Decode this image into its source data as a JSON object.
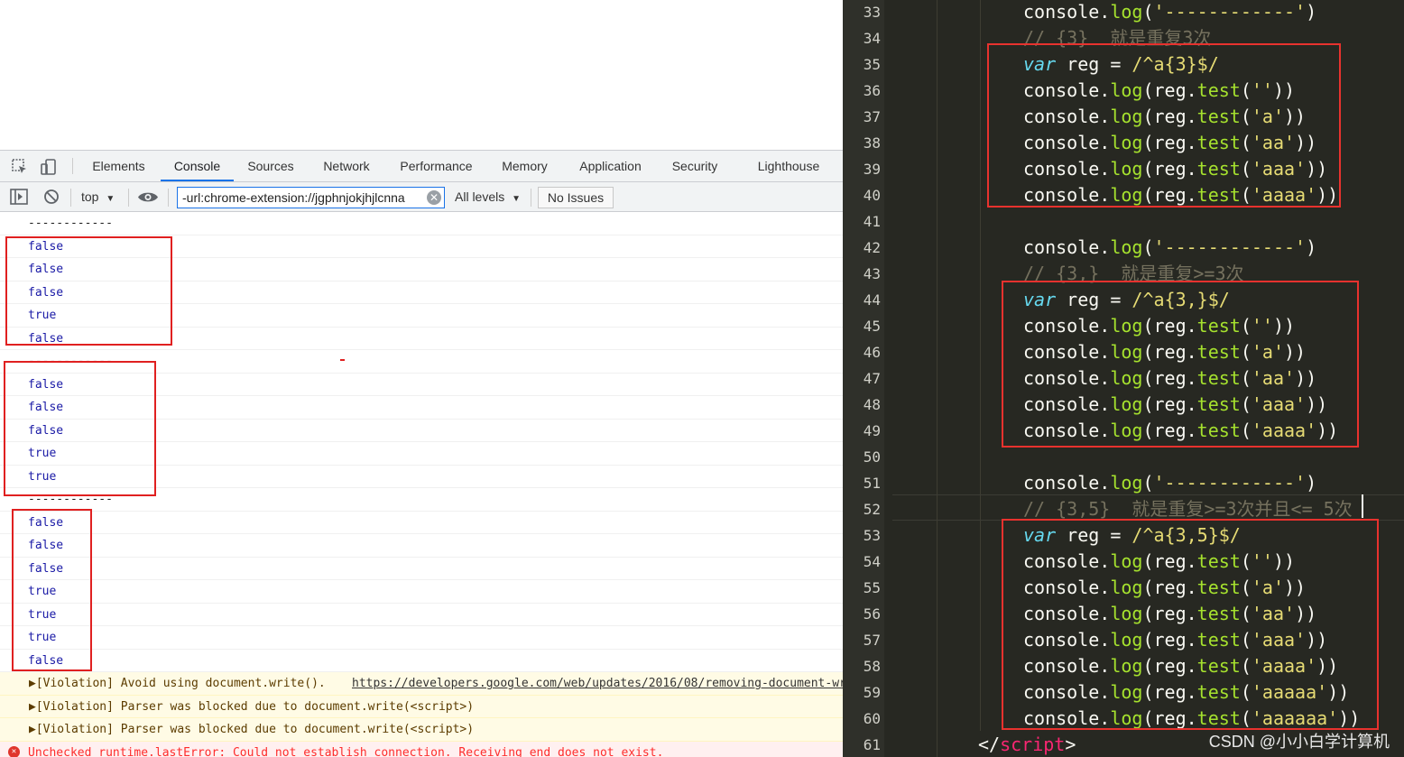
{
  "devtools": {
    "tabs": [
      "Elements",
      "Console",
      "Sources",
      "Network",
      "Performance",
      "Memory",
      "Application",
      "Security",
      "Lighthouse"
    ],
    "active_tab": "Console",
    "context_select": "top",
    "filter_value": "-url:chrome-extension://jgphnjokjhjlcnna",
    "levels_select": "All levels",
    "issues_button": "No Issues"
  },
  "console_rows": [
    {
      "text": "------------",
      "kind": "sep"
    },
    {
      "text": "false",
      "kind": "val"
    },
    {
      "text": "false",
      "kind": "val"
    },
    {
      "text": "false",
      "kind": "val"
    },
    {
      "text": "true",
      "kind": "val"
    },
    {
      "text": "false",
      "kind": "val"
    },
    {
      "text": "------------",
      "kind": "sep"
    },
    {
      "text": "false",
      "kind": "val"
    },
    {
      "text": "false",
      "kind": "val"
    },
    {
      "text": "false",
      "kind": "val"
    },
    {
      "text": "true",
      "kind": "val"
    },
    {
      "text": "true",
      "kind": "val"
    },
    {
      "text": "------------",
      "kind": "sep"
    },
    {
      "text": "false",
      "kind": "val"
    },
    {
      "text": "false",
      "kind": "val"
    },
    {
      "text": "false",
      "kind": "val"
    },
    {
      "text": "true",
      "kind": "val"
    },
    {
      "text": "true",
      "kind": "val"
    },
    {
      "text": "true",
      "kind": "val"
    },
    {
      "text": "false",
      "kind": "val"
    }
  ],
  "violations": [
    {
      "prefix": "▶[Violation] Avoid using document.write(). ",
      "link": "https://developers.google.com/web/updates/2016/08/removing-document-write"
    },
    {
      "prefix": "▶[Violation] Parser was blocked due to document.write(<script>)",
      "link": ""
    },
    {
      "prefix": "▶[Violation] Parser was blocked due to document.write(<script>)",
      "link": ""
    }
  ],
  "error_row": "Unchecked runtime.lastError: Could not establish connection. Receiving end does not exist.",
  "editor": {
    "lines": [
      {
        "n": "33",
        "html": "console.<span class='fn'>log</span>(<span class='str'>'------------'</span>)"
      },
      {
        "n": "34",
        "html": "<span class='cmt'>// {3}  就是重复3次</span>"
      },
      {
        "n": "35",
        "html": "<span class='kw'>var</span> reg = <span class='str'>/^a{3}$/</span>"
      },
      {
        "n": "36",
        "html": "console.<span class='fn'>log</span>(reg.<span class='fn'>test</span>(<span class='str'>''</span>))"
      },
      {
        "n": "37",
        "html": "console.<span class='fn'>log</span>(reg.<span class='fn'>test</span>(<span class='str'>'a'</span>))"
      },
      {
        "n": "38",
        "html": "console.<span class='fn'>log</span>(reg.<span class='fn'>test</span>(<span class='str'>'aa'</span>))"
      },
      {
        "n": "39",
        "html": "console.<span class='fn'>log</span>(reg.<span class='fn'>test</span>(<span class='str'>'aaa'</span>))"
      },
      {
        "n": "40",
        "html": "console.<span class='fn'>log</span>(reg.<span class='fn'>test</span>(<span class='str'>'aaaa'</span>))"
      },
      {
        "n": "41",
        "html": ""
      },
      {
        "n": "42",
        "html": "console.<span class='fn'>log</span>(<span class='str'>'------------'</span>)"
      },
      {
        "n": "43",
        "html": "<span class='cmt'>// {3,}  就是重复>=3次</span>"
      },
      {
        "n": "44",
        "html": "<span class='kw'>var</span> reg = <span class='str'>/^a{3,}$/</span>"
      },
      {
        "n": "45",
        "html": "console.<span class='fn'>log</span>(reg.<span class='fn'>test</span>(<span class='str'>''</span>))"
      },
      {
        "n": "46",
        "html": "console.<span class='fn'>log</span>(reg.<span class='fn'>test</span>(<span class='str'>'a'</span>))"
      },
      {
        "n": "47",
        "html": "console.<span class='fn'>log</span>(reg.<span class='fn'>test</span>(<span class='str'>'aa'</span>))"
      },
      {
        "n": "48",
        "html": "console.<span class='fn'>log</span>(reg.<span class='fn'>test</span>(<span class='str'>'aaa'</span>))"
      },
      {
        "n": "49",
        "html": "console.<span class='fn'>log</span>(reg.<span class='fn'>test</span>(<span class='str'>'aaaa'</span>))"
      },
      {
        "n": "50",
        "html": ""
      },
      {
        "n": "51",
        "html": "console.<span class='fn'>log</span>(<span class='str'>'------------'</span>)"
      },
      {
        "n": "52",
        "html": "<span class='cmt'>// {3,5}  就是重复>=3次并且<= 5次</span>"
      },
      {
        "n": "53",
        "html": "<span class='kw'>var</span> reg = <span class='str'>/^a{3,5}$/</span>"
      },
      {
        "n": "54",
        "html": "console.<span class='fn'>log</span>(reg.<span class='fn'>test</span>(<span class='str'>''</span>))"
      },
      {
        "n": "55",
        "html": "console.<span class='fn'>log</span>(reg.<span class='fn'>test</span>(<span class='str'>'a'</span>))"
      },
      {
        "n": "56",
        "html": "console.<span class='fn'>log</span>(reg.<span class='fn'>test</span>(<span class='str'>'aa'</span>))"
      },
      {
        "n": "57",
        "html": "console.<span class='fn'>log</span>(reg.<span class='fn'>test</span>(<span class='str'>'aaa'</span>))"
      },
      {
        "n": "58",
        "html": "console.<span class='fn'>log</span>(reg.<span class='fn'>test</span>(<span class='str'>'aaaa'</span>))"
      },
      {
        "n": "59",
        "html": "console.<span class='fn'>log</span>(reg.<span class='fn'>test</span>(<span class='str'>'aaaaa'</span>))"
      },
      {
        "n": "60",
        "html": "console.<span class='fn'>log</span>(reg.<span class='fn'>test</span>(<span class='str'>'aaaaaa'</span>))"
      },
      {
        "n": "61",
        "html": "&lt;/<span class='tag'>script</span>&gt;"
      }
    ]
  },
  "watermark": "CSDN @小小白学计算机",
  "colors": {
    "annotation_red": "#e02020",
    "editor_bg": "#272822",
    "accent": "#1a73e8"
  }
}
